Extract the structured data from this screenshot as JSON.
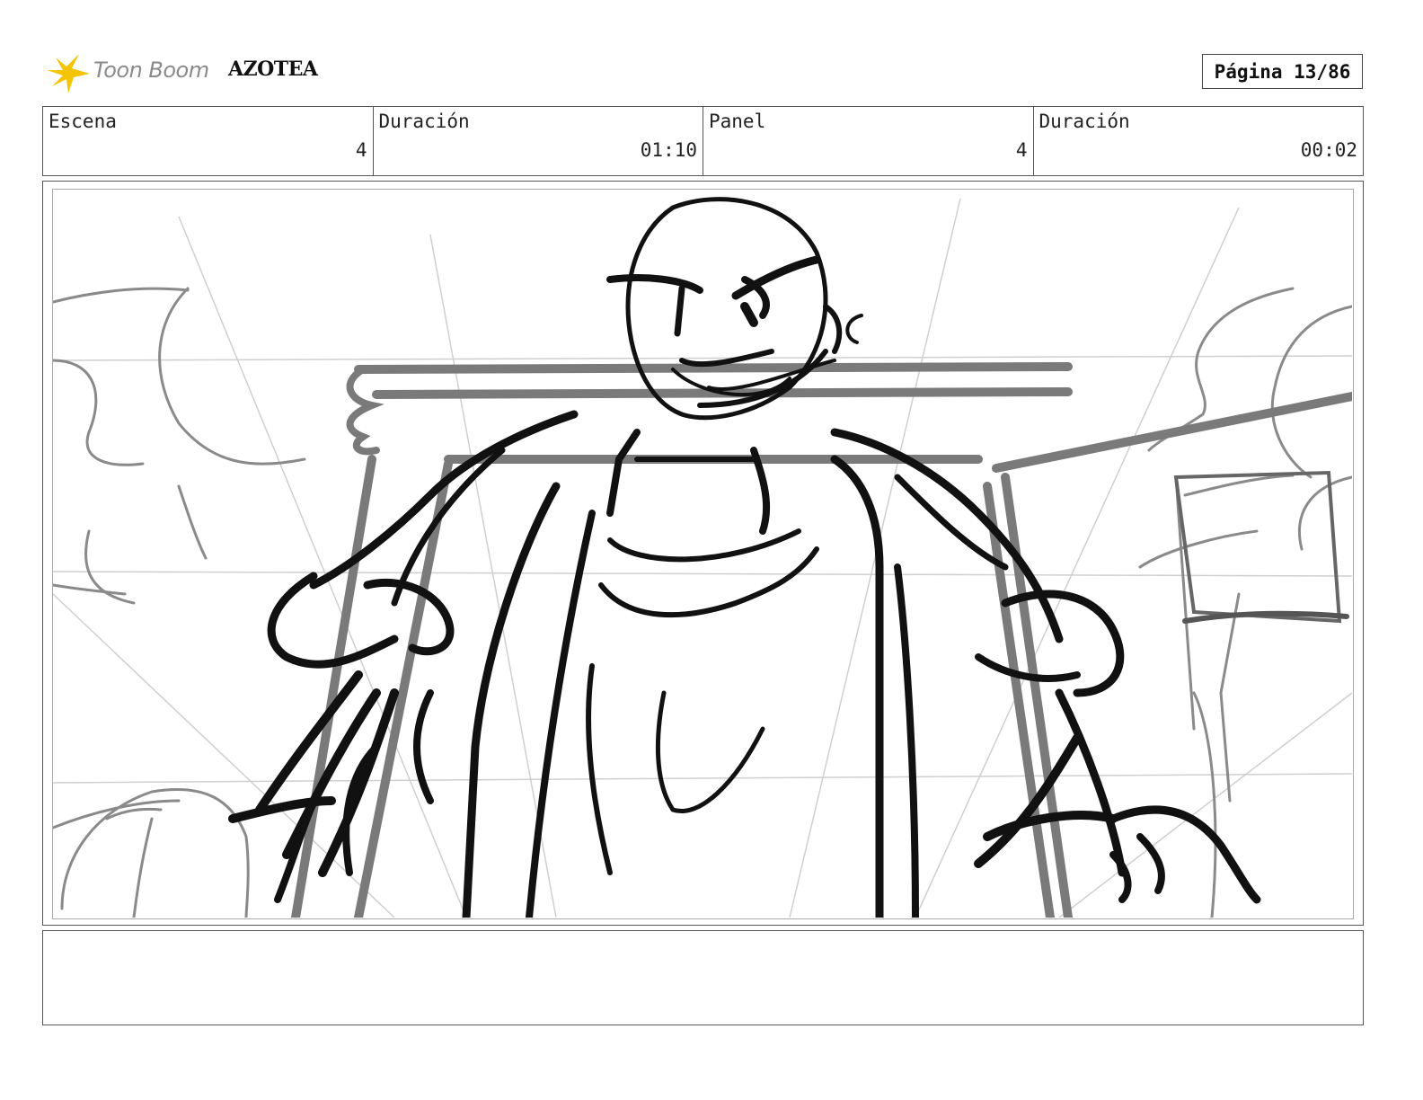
{
  "header": {
    "logo_text": "Toon Boom",
    "project_title": "AZOTEA",
    "page_label": "Página 13/86"
  },
  "info": {
    "scene_label": "Escena",
    "scene_value": "4",
    "scene_duration_label": "Duración",
    "scene_duration_value": "01:10",
    "panel_label": "Panel",
    "panel_value": "4",
    "panel_duration_label": "Duración",
    "panel_duration_value": "00:02"
  },
  "notes": {
    "text": ""
  },
  "colors": {
    "logo_yellow": "#f5c400",
    "logo_text_gray": "#8a8a8a",
    "sketch_black": "#111111",
    "sketch_gray": "#7a7a7a"
  }
}
